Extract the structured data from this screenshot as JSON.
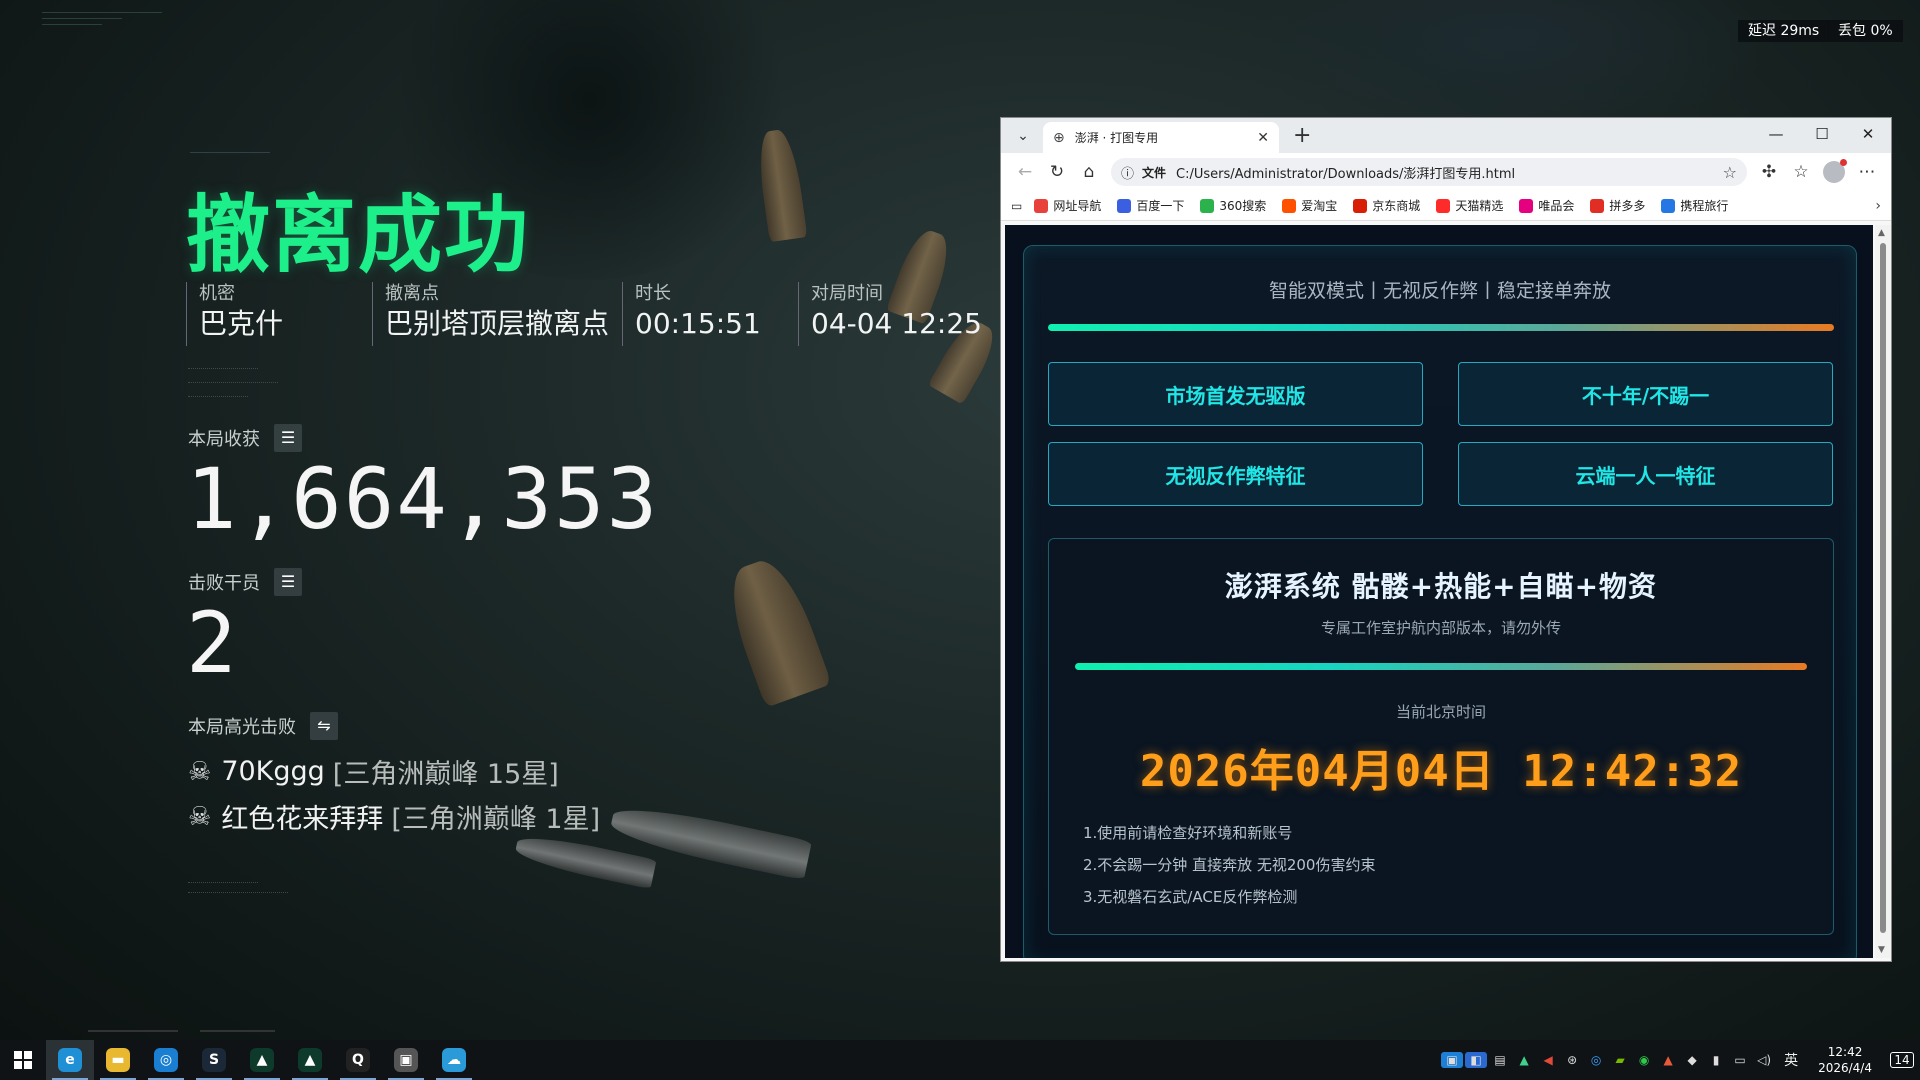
{
  "game": {
    "title": "撤离成功",
    "info": [
      {
        "label": "机密",
        "value": "巴克什"
      },
      {
        "label": "撤离点",
        "value": "巴别塔顶层撤离点"
      },
      {
        "label": "时长",
        "value": "00:15:51"
      },
      {
        "label": "对局时间",
        "value": "04-04 12:25"
      }
    ],
    "loot_label": "本局收获",
    "loot_value": "1,664,353",
    "kills_label": "击败干员",
    "kills_value": "2",
    "highlight_label": "本局高光击败",
    "highlights": [
      {
        "name": "70Kggg",
        "rank": "[三角洲巅峰 15星]"
      },
      {
        "name": "红色花来拜拜",
        "rank": "[三角洲巅峰 1星]"
      }
    ]
  },
  "network": {
    "latency": "延迟 29ms",
    "loss": "丢包 0%"
  },
  "browser": {
    "tab_title": "澎湃 · 打图专用",
    "url_prefix": "文件",
    "url": "C:/Users/Administrator/Downloads/澎湃打图专用.html",
    "favorites": [
      {
        "label": "网址导航",
        "color": "#e8403a"
      },
      {
        "label": "百度一下",
        "color": "#3a5fe0"
      },
      {
        "label": "360搜索",
        "color": "#2bb24c"
      },
      {
        "label": "爱淘宝",
        "color": "#ff5000"
      },
      {
        "label": "京东商城",
        "color": "#d81e06"
      },
      {
        "label": "天猫精选",
        "color": "#ff2b2b"
      },
      {
        "label": "唯品会",
        "color": "#e4007f"
      },
      {
        "label": "拼多多",
        "color": "#e02e24"
      },
      {
        "label": "携程旅行",
        "color": "#2577e3"
      }
    ]
  },
  "page": {
    "slogan": "智能双模式丨无视反作弊丨稳定接单奔放",
    "buttons": [
      "市场首发无驱版",
      "不十年/不踢一",
      "无视反作弊特征",
      "云端一人一特征"
    ],
    "system_title": "澎湃系统  骷髅+热能+自瞄+物资",
    "system_sub": "专属工作室护航内部版本，请勿外传",
    "time_label": "当前北京时间",
    "clock": "2026年04月04日 12:42:32",
    "rules": [
      "1.使用前请检查好环境和新账号",
      "2.不会踢一分钟 直接奔放 无视200伤害约束",
      "3.无视磐石玄武/ACE反作弊检测"
    ]
  },
  "taskbar": {
    "time": "12:42",
    "date": "2026/4/4",
    "lang": "英",
    "notifications": "14",
    "apps": [
      {
        "name": "edge",
        "color": "#1f8fd6",
        "glyph": "e"
      },
      {
        "name": "explorer",
        "color": "#e8b830",
        "glyph": "▬"
      },
      {
        "name": "browser-blue",
        "color": "#1a7fd0",
        "glyph": "◎"
      },
      {
        "name": "steam",
        "color": "#1b2838",
        "glyph": "S"
      },
      {
        "name": "game-green-1",
        "color": "#0d3a2a",
        "glyph": "▲"
      },
      {
        "name": "game-green-2",
        "color": "#0d3a2a",
        "glyph": "▲"
      },
      {
        "name": "qq",
        "color": "#222",
        "glyph": "Q"
      },
      {
        "name": "tool-gray",
        "color": "#555",
        "glyph": "▣"
      },
      {
        "name": "cloud-app",
        "color": "#2a9ad8",
        "glyph": "☁"
      }
    ]
  }
}
